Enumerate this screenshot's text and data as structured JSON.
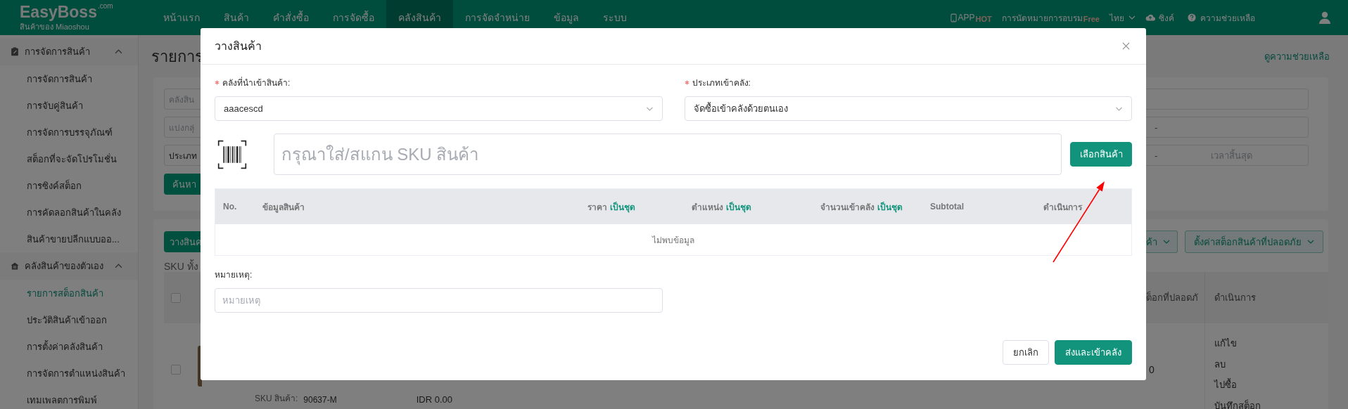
{
  "topbar": {
    "logo": "EasyBoss",
    "logo_suffix": ".com",
    "tagline": "สินค้าของ Miaoshou",
    "nav": [
      {
        "label": "หน้าแรก",
        "selected": false
      },
      {
        "label": "สินค้า",
        "selected": false
      },
      {
        "label": "คำสั่งซื้อ",
        "selected": false
      },
      {
        "label": "การจัดซื้อ",
        "selected": false
      },
      {
        "label": "คลังสินค้า",
        "selected": true
      },
      {
        "label": "การจัดจำหน่าย",
        "selected": false
      },
      {
        "label": "ข้อมูล",
        "selected": false
      },
      {
        "label": "ระบบ",
        "selected": false
      }
    ],
    "app": {
      "label": "APP",
      "badge": "HOT"
    },
    "training": {
      "label": "การนัดหมายการอบรม",
      "badge": "Free"
    },
    "language": "ไทย",
    "sync": "ซิงค์",
    "help": "ความช่วยเหลือ"
  },
  "sidebar": {
    "groups": [
      {
        "label": "การจัดการสินค้า",
        "expanded": true,
        "items": [
          {
            "label": "การจัดการสินค้า",
            "selected": false
          },
          {
            "label": "การจับคู่สินค้า",
            "selected": false
          },
          {
            "label": "การจัดการบรรจุภัณฑ์",
            "selected": false
          },
          {
            "label": "สต็อกที่จะจัดโปรโมชั่น",
            "selected": false
          },
          {
            "label": "การซิงค์สต็อก",
            "selected": false
          },
          {
            "label": "การคัดลอกสินค้าในคลัง",
            "selected": false
          },
          {
            "label": "สินค้าขายปลีกแบบออ...",
            "selected": false
          }
        ]
      },
      {
        "label": "คลังสินค้าของตัวเอง",
        "expanded": true,
        "items": [
          {
            "label": "รายการสต็อกสินค้า",
            "selected": true
          },
          {
            "label": "ประวัติสินค้าเข้าออก",
            "selected": false
          },
          {
            "label": "การตั้งค่าคลังสินค้า",
            "selected": false
          },
          {
            "label": "การจัดการตำแหน่งสินค้า",
            "selected": false
          },
          {
            "label": "เทมเพลตการพิมพ์",
            "selected": false
          }
        ]
      }
    ]
  },
  "background": {
    "title": "รายการ",
    "help_link": "ดูความช่วยเหลือ",
    "filters": [
      {
        "placeholder": "คลังสิน"
      },
      {
        "placeholder": "แบ่งกลุ่",
        "range_separator": "-"
      },
      {
        "value": "ประเภท",
        "range_separator": "-",
        "end_placeholder": "เวลาสิ้นสุด"
      }
    ],
    "search_button": "ค้นหา",
    "place_button": "วางสินค",
    "dropdown": "ค้า",
    "safe_stock_button": "ตั้งค่าสต็อกสินค้าที่ปลอดภัย",
    "sku_count": "SKU ทั้ง",
    "table": {
      "select_all": {
        "checked": false
      },
      "column_fragment": "ต็อกที่ปลอดภั",
      "actions_header": "ดำเนินการ",
      "rows": [
        {
          "checked": false,
          "sku_label": "SKU สินค้า:",
          "sku": "90637-M",
          "price": "IDR 0.00",
          "stock": "0",
          "actions": [
            "แก้ไข",
            "ลบ",
            "ไปซื้อ",
            "บันทึกสต็อก"
          ]
        }
      ]
    }
  },
  "dialog": {
    "title": "วางสินค้า",
    "fields": [
      {
        "label": "คลังที่นำเข้าสินค้า:",
        "required": true,
        "value": "aaacescd"
      },
      {
        "label": "ประเภทเข้าคลัง:",
        "required": true,
        "value": "จัดซื้อเข้าคลังด้วยตนเอง"
      }
    ],
    "sku_input": {
      "placeholder": "กรุณาใส่/สแกน SKU สินค้า"
    },
    "select_button": "เลือกสินค้า",
    "table": {
      "columns": [
        {
          "label": "No."
        },
        {
          "label": "ข้อมูลสินค้า"
        },
        {
          "label": "ราคา",
          "link": "เป็นชุด"
        },
        {
          "label": "ตำแหน่ง",
          "link": "เป็นชุด"
        },
        {
          "label": "จำนวนเข้าคลัง",
          "link": "เป็นชุด"
        },
        {
          "label": "Subtotal"
        },
        {
          "label": "ดำเนินการ"
        }
      ],
      "empty_text": "ไม่พบข้อมูล"
    },
    "remark": {
      "label": "หมายเหตุ:",
      "placeholder": "หมายเหตุ"
    },
    "buttons": [
      {
        "label": "ยกเลิก",
        "kind": "secondary"
      },
      {
        "label": "ส่งและเข้าคลัง",
        "kind": "primary"
      }
    ]
  }
}
